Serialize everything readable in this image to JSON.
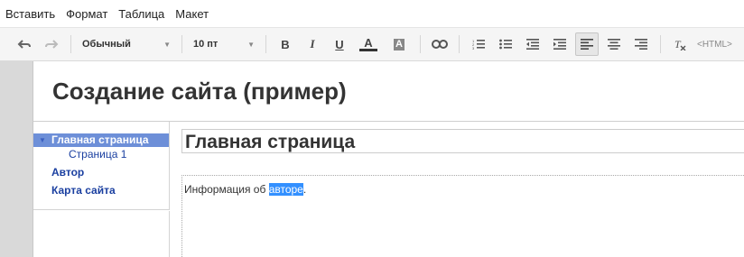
{
  "menubar": {
    "items": [
      "Вставить",
      "Формат",
      "Таблица",
      "Макет"
    ]
  },
  "toolbar": {
    "style_value": "Обычный",
    "size_value": "10 пт",
    "bold_label": "B",
    "italic_label": "I",
    "underline_label": "U",
    "textcolor_label": "A",
    "bgcolor_label": "A",
    "html_label": "<HTML>"
  },
  "site": {
    "title": "Создание сайта (пример)"
  },
  "sidebar": {
    "items": [
      {
        "label": "Главная страница"
      },
      {
        "label": "Страница 1"
      },
      {
        "label": "Автор"
      },
      {
        "label": "Карта сайта"
      }
    ]
  },
  "content": {
    "heading": "Главная страница",
    "text_before": "Информация об ",
    "text_selected": "авторе",
    "text_after": "."
  },
  "colors": {
    "nav_selected_bg": "#6d8fd8",
    "nav_link": "#1a3fa0",
    "selection": "#3390ff"
  }
}
